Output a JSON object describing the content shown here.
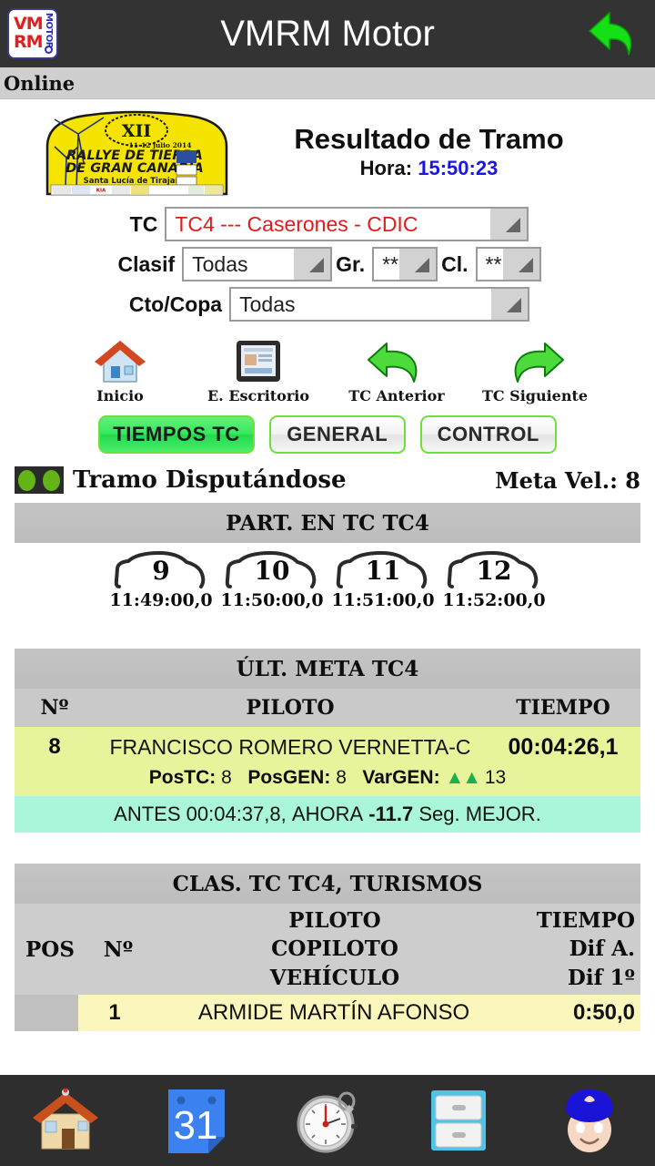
{
  "appbar": {
    "title": "VMRM Motor",
    "logo_text_top": "VM",
    "logo_text_bottom": "RM",
    "logo_text_side": "MOTOR",
    "back_icon": "back-arrow-icon"
  },
  "status_strip": {
    "text": "Online"
  },
  "header": {
    "title": "Resultado de Tramo",
    "hora_label": "Hora:",
    "hora_value": "15:50:23",
    "hora_color": "#1a18e0",
    "rally_logo": {
      "edition": "XII",
      "dates": "11-12 julio 2014",
      "line1": "RALLYE  DE  TIERRA",
      "line2": "DE  GRAN  CANARIA",
      "line3": "Santa Lucía de Tirajana",
      "sponsor": "KIA"
    }
  },
  "selectors": [
    {
      "label": "TC",
      "value": "TC4 --- Caserones - CDIC",
      "value_color": "#e21b1b"
    },
    {
      "label": "Clasif",
      "value": "Todas",
      "value_color": "#202020"
    },
    {
      "label": "Gr.",
      "value": "**",
      "value_color": "#202020"
    },
    {
      "label": "Cl.",
      "value": "**",
      "value_color": "#202020"
    },
    {
      "label": "Cto/Copa",
      "value": "Todas",
      "value_color": "#202020"
    }
  ],
  "icon_nav": [
    {
      "caption": "Inicio",
      "icon": "home-icon"
    },
    {
      "caption": "E. Escritorio",
      "icon": "tablet-desktop-icon"
    },
    {
      "caption": "TC Anterior",
      "icon": "arrow-left-curved-icon"
    },
    {
      "caption": "TC Siguiente",
      "icon": "arrow-right-curved-icon"
    }
  ],
  "tabs": [
    {
      "label": "TIEMPOS TC",
      "active": true
    },
    {
      "label": "GENERAL",
      "active": false
    },
    {
      "label": "CONTROL",
      "active": false
    }
  ],
  "stage_status": {
    "icon": "traffic-lights-green-icon",
    "text": "Tramo Disputándose",
    "right_text": "Meta Vel.: 8"
  },
  "participants_panel": {
    "title": "PART. EN TC TC4",
    "cars": [
      {
        "number": "9",
        "time": "11:49:00,0"
      },
      {
        "number": "10",
        "time": "11:50:00,0"
      },
      {
        "number": "11",
        "time": "11:51:00,0"
      },
      {
        "number": "12",
        "time": "11:52:00,0"
      }
    ]
  },
  "last_finish_panel": {
    "title": "ÚLT. META TC4",
    "columns": [
      "Nº",
      "PILOTO",
      "TIEMPO"
    ],
    "row": {
      "number": "8",
      "driver": "FRANCISCO ROMERO VERNETTA-C",
      "time": "00:04:26,1",
      "postc_label": "PosTC:",
      "postc_value": "8",
      "posgen_label": "PosGEN:",
      "posgen_value": "8",
      "vargen_label": "VarGEN:",
      "vargen_arrow": "double-chevron-up-icon",
      "vargen_value": "13",
      "vargen_color": "#1faf4e"
    },
    "comparison": {
      "before_label": "ANTES",
      "before_time": "00:04:37,8,",
      "now_label": "AHORA",
      "delta": "-11.7",
      "unit_label": "Seg. MEJOR."
    },
    "row_bg": "#e8f49b",
    "comparison_bg": "#aaf6d8"
  },
  "classification_panel": {
    "title": "CLAS. TC TC4, TURISMOS",
    "columns": {
      "pos": "POS",
      "num": "Nº",
      "center": [
        "PILOTO",
        "COPILOTO",
        "VEHÍCULO"
      ],
      "right": [
        "TIEMPO",
        "Dif A.",
        "Dif 1º"
      ]
    },
    "rows": [
      {
        "pos": "",
        "num": "1",
        "driver": "ARMIDE MARTÍN AFONSO",
        "time": "0:50,0"
      }
    ]
  },
  "bottom_nav": [
    {
      "icon": "home-icon",
      "name": "home"
    },
    {
      "icon": "calendar-31-icon",
      "name": "calendar"
    },
    {
      "icon": "stopwatch-icon",
      "name": "stopwatch"
    },
    {
      "icon": "file-cabinet-icon",
      "name": "files"
    },
    {
      "icon": "police-officer-icon",
      "name": "control"
    }
  ]
}
